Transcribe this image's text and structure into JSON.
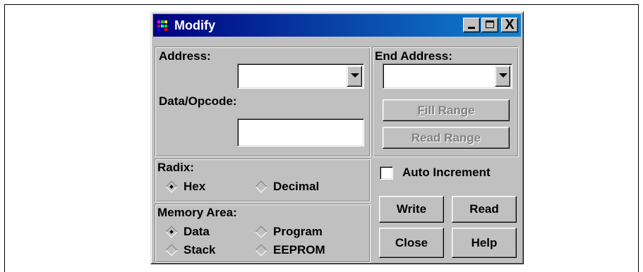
{
  "window": {
    "title": "Modify",
    "minimize_label": "_",
    "maximize_label": "□",
    "close_label": "X"
  },
  "address": {
    "label": "Address:",
    "value": ""
  },
  "data_opcode": {
    "label": "Data/Opcode:",
    "value": ""
  },
  "end_address": {
    "label": "End Address:",
    "value": ""
  },
  "buttons": {
    "fill_range": "Fill Range",
    "read_range": "Read Range",
    "write": "Write",
    "read": "Read",
    "close": "Close",
    "help": "Help"
  },
  "radix": {
    "label": "Radix:",
    "options": [
      "Hex",
      "Decimal"
    ],
    "selected": "Hex"
  },
  "auto_increment": {
    "label": "Auto Increment",
    "checked": false
  },
  "memory_area": {
    "label": "Memory Area:",
    "options": [
      "Data",
      "Program",
      "Stack",
      "EEPROM"
    ],
    "selected": "Data"
  },
  "icons": {
    "app": "modify-app-icon",
    "dropdown": "chevron-down-icon"
  },
  "colors": {
    "title_gradient_start": "#000080",
    "title_gradient_end": "#1084d0",
    "face": "#c0c0c0"
  }
}
